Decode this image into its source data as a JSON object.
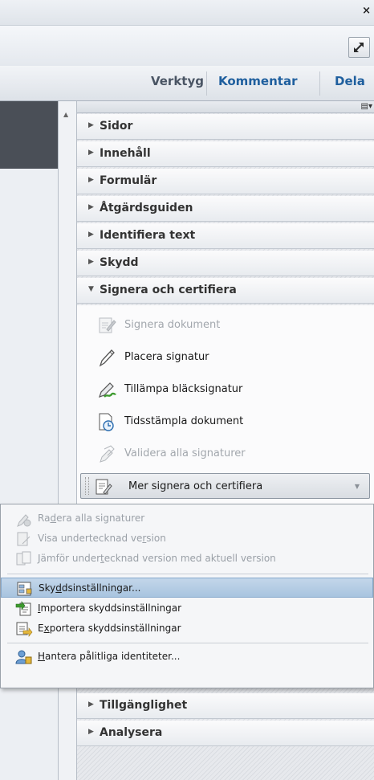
{
  "window": {
    "close_glyph": "×"
  },
  "tabs": [
    {
      "label": "Verktyg"
    },
    {
      "label": "Kommentar"
    },
    {
      "label": "Dela"
    }
  ],
  "panel": {
    "sections_top": [
      {
        "label": "Sidor"
      },
      {
        "label": "Innehåll"
      },
      {
        "label": "Formulär"
      },
      {
        "label": "Åtgärdsguiden"
      },
      {
        "label": "Identifiera text"
      },
      {
        "label": "Skydd"
      }
    ],
    "expanded": {
      "label": "Signera och certifiera"
    },
    "tools": [
      {
        "label": "Signera dokument",
        "icon": "sign-document-icon",
        "enabled": false
      },
      {
        "label": "Placera signatur",
        "icon": "pen-icon",
        "enabled": true
      },
      {
        "label": "Tillämpa bläcksignatur",
        "icon": "ink-signature-icon",
        "enabled": true
      },
      {
        "label": "Tidsstämpla dokument",
        "icon": "timestamp-icon",
        "enabled": true
      },
      {
        "label": "Validera alla signaturer",
        "icon": "validate-signatures-icon",
        "enabled": false
      }
    ],
    "more": {
      "label": "Mer signera och certifiera"
    },
    "sections_bottom": [
      {
        "label": "Tillgänglighet"
      },
      {
        "label": "Analysera"
      }
    ]
  },
  "menu": {
    "items": [
      {
        "pre": "Ra",
        "key": "d",
        "post": "era alla signaturer",
        "enabled": false
      },
      {
        "pre": "Visa undertecknad ve",
        "key": "r",
        "post": "sion",
        "enabled": false
      },
      {
        "pre": "Jämför under",
        "key": "t",
        "post": "ecknad version med aktuell version",
        "enabled": false
      },
      {
        "pre": "Sky",
        "key": "d",
        "post": "dsinställningar...",
        "enabled": true,
        "selected": true
      },
      {
        "pre": "",
        "key": "I",
        "post": "mportera skyddsinställningar",
        "enabled": true
      },
      {
        "pre": "E",
        "key": "x",
        "post": "portera skyddsinställningar",
        "enabled": true
      },
      {
        "pre": "",
        "key": "H",
        "post": "antera pålitliga identiteter...",
        "enabled": true
      }
    ]
  },
  "colors": {
    "selected": "#a8c4df",
    "tab_link": "#1f5f9e"
  }
}
